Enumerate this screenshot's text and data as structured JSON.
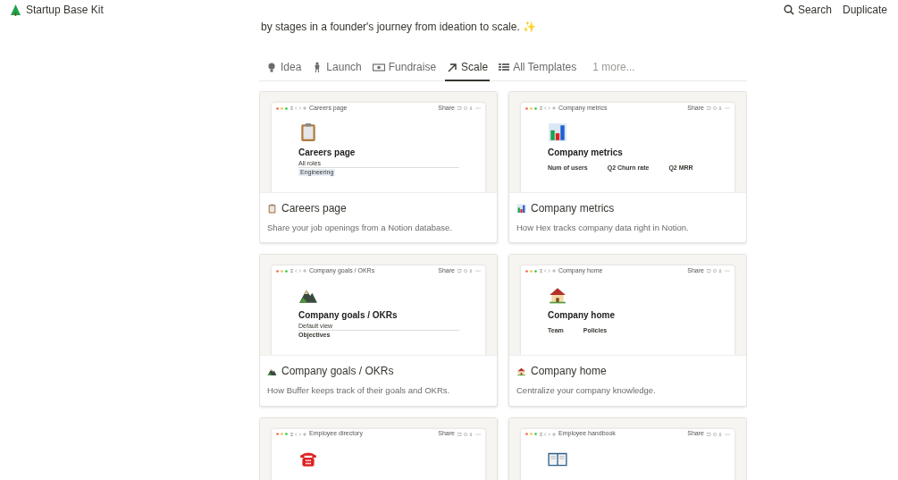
{
  "header": {
    "title": "Startup Base Kit",
    "search": "Search",
    "duplicate": "Duplicate"
  },
  "intro": "by stages in a founder's journey from ideation to scale. ✨",
  "tabs": [
    {
      "label": "Idea",
      "selected": false
    },
    {
      "label": "Launch",
      "selected": false
    },
    {
      "label": "Fundraise",
      "selected": false
    },
    {
      "label": "Scale",
      "selected": true
    },
    {
      "label": "All Templates",
      "selected": false
    },
    {
      "label": "1 more...",
      "selected": false
    }
  ],
  "cards": [
    {
      "title": "Careers page",
      "description": "Share your job openings from a Notion database.",
      "preview": {
        "window_title": "Careers page",
        "share": "Share",
        "page_title": "Careers page",
        "view": "All roles",
        "group": "Engineering"
      }
    },
    {
      "title": "Company metrics",
      "description": "How Hex tracks company data right in Notion.",
      "preview": {
        "window_title": "Company metrics",
        "share": "Share",
        "page_title": "Company metrics",
        "properties": [
          "Num of users",
          "Q2 Churn rate",
          "Q2 MRR"
        ]
      }
    },
    {
      "title": "Company goals / OKRs",
      "description": "How Buffer keeps track of their goals and OKRs.",
      "preview": {
        "window_title": "Company goals / OKRs",
        "share": "Share",
        "page_title": "Company goals / OKRs",
        "view": "Default view",
        "heading": "Objectives"
      }
    },
    {
      "title": "Company home",
      "description": "Centralize your company knowledge.",
      "preview": {
        "window_title": "Company home",
        "share": "Share",
        "page_title": "Company home",
        "properties": [
          "Team",
          "Policies"
        ]
      }
    },
    {
      "preview": {
        "window_title": "Employee directory",
        "share": "Share"
      }
    },
    {
      "preview": {
        "window_title": "Employee handbook",
        "share": "Share"
      }
    }
  ]
}
